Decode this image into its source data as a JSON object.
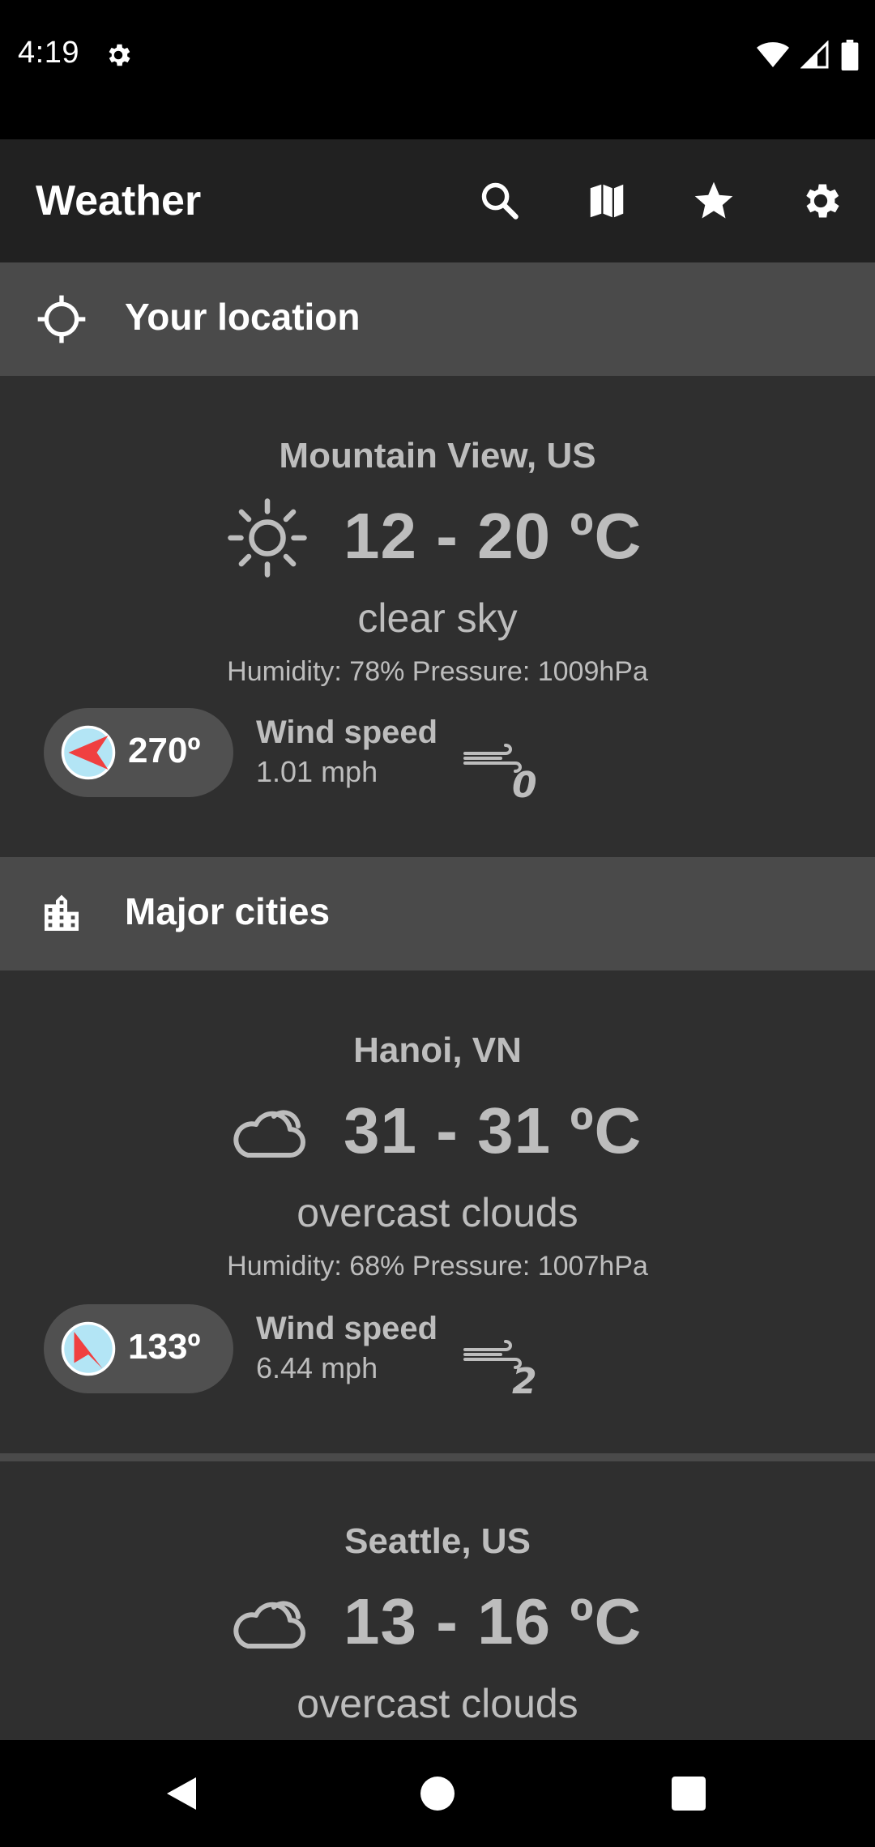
{
  "status_bar": {
    "time": "4:19",
    "icons": [
      "settings-icon",
      "wifi-icon",
      "signal-icon",
      "battery-icon"
    ]
  },
  "app_bar": {
    "title": "Weather",
    "actions": [
      "search-icon",
      "map-icon",
      "star-icon",
      "settings-icon"
    ]
  },
  "sections": {
    "your_location": {
      "label": "Your location",
      "icon": "crosshair-icon"
    },
    "major_cities": {
      "label": "Major cities",
      "icon": "city-icon"
    }
  },
  "cards": [
    {
      "city": "Mountain View, US",
      "icon": "sun-icon",
      "temp": "12 - 20 ºC",
      "description": "clear sky",
      "details": "Humidity: 78% Pressure: 1009hPa",
      "wind_deg": "270º",
      "wind_label": "Wind speed",
      "wind_speed": "1.01 mph",
      "beaufort": "0"
    },
    {
      "city": "Hanoi, VN",
      "icon": "cloud-icon",
      "temp": "31 - 31 ºC",
      "description": "overcast clouds",
      "details": "Humidity: 68% Pressure: 1007hPa",
      "wind_deg": "133º",
      "wind_label": "Wind speed",
      "wind_speed": "6.44 mph",
      "beaufort": "2"
    },
    {
      "city": "Seattle, US",
      "icon": "cloud-icon",
      "temp": "13 - 16 ºC",
      "description": "overcast clouds"
    }
  ],
  "colors": {
    "background": "#2f2f2f",
    "app_bar": "#212121",
    "section_header": "#4a4a4a",
    "text_primary": "#ffffff",
    "text_secondary": "#bdbdbd",
    "compass_fill": "#b3e5f5",
    "compass_needle": "#f04040"
  },
  "nav_bar": {
    "buttons": [
      "back-icon",
      "home-icon",
      "recents-icon"
    ]
  }
}
